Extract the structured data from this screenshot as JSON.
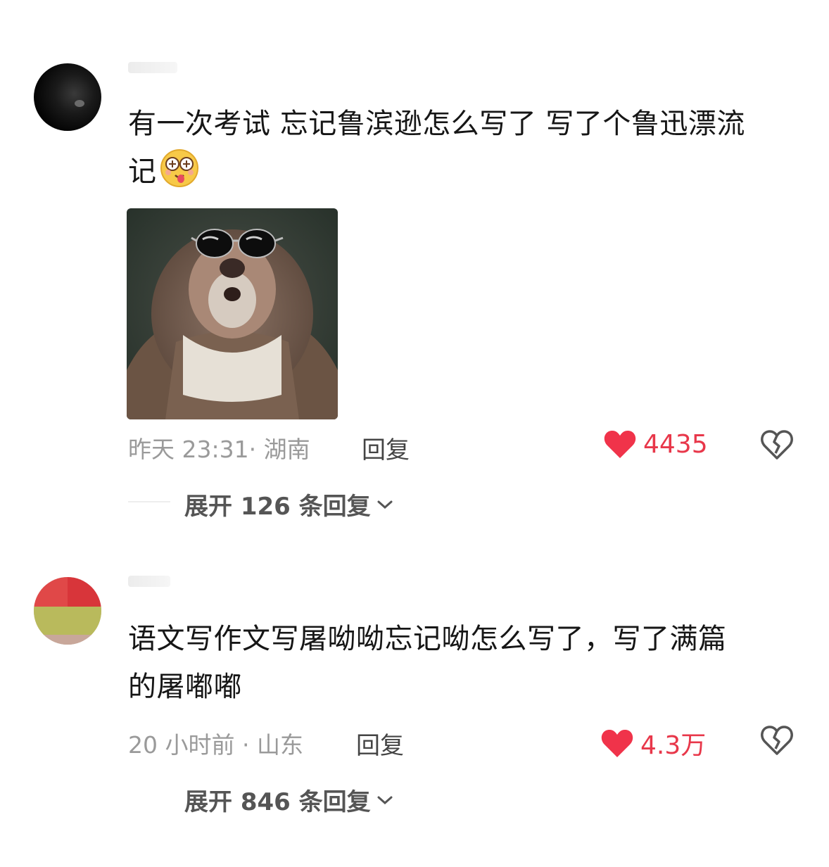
{
  "comments": [
    {
      "text_line1": "有一次考试 忘记鲁滨逊怎么写了 写了个鲁迅漂流",
      "text_line2": "记",
      "emoji": "drunk-face-emoji",
      "has_image": true,
      "time": "昨天 23:31· 湖南",
      "reply": "回复",
      "likes": "4435",
      "expand": "展开 126 条回复"
    },
    {
      "text_line1": "语文写作文写屠呦呦忘记呦怎么写了，写了满篇",
      "text_line2": "的屠嘟嘟",
      "time": "20 小时前 · 山东",
      "reply": "回复",
      "likes": "4.3万",
      "expand": "展开 846 条回复"
    }
  ],
  "colors": {
    "like": "#e8374a",
    "meta": "#9a9a9a",
    "text": "#161616"
  },
  "icons": {
    "like": "heart-icon",
    "dislike": "broken-heart-icon",
    "expand": "chevron-down-icon"
  }
}
